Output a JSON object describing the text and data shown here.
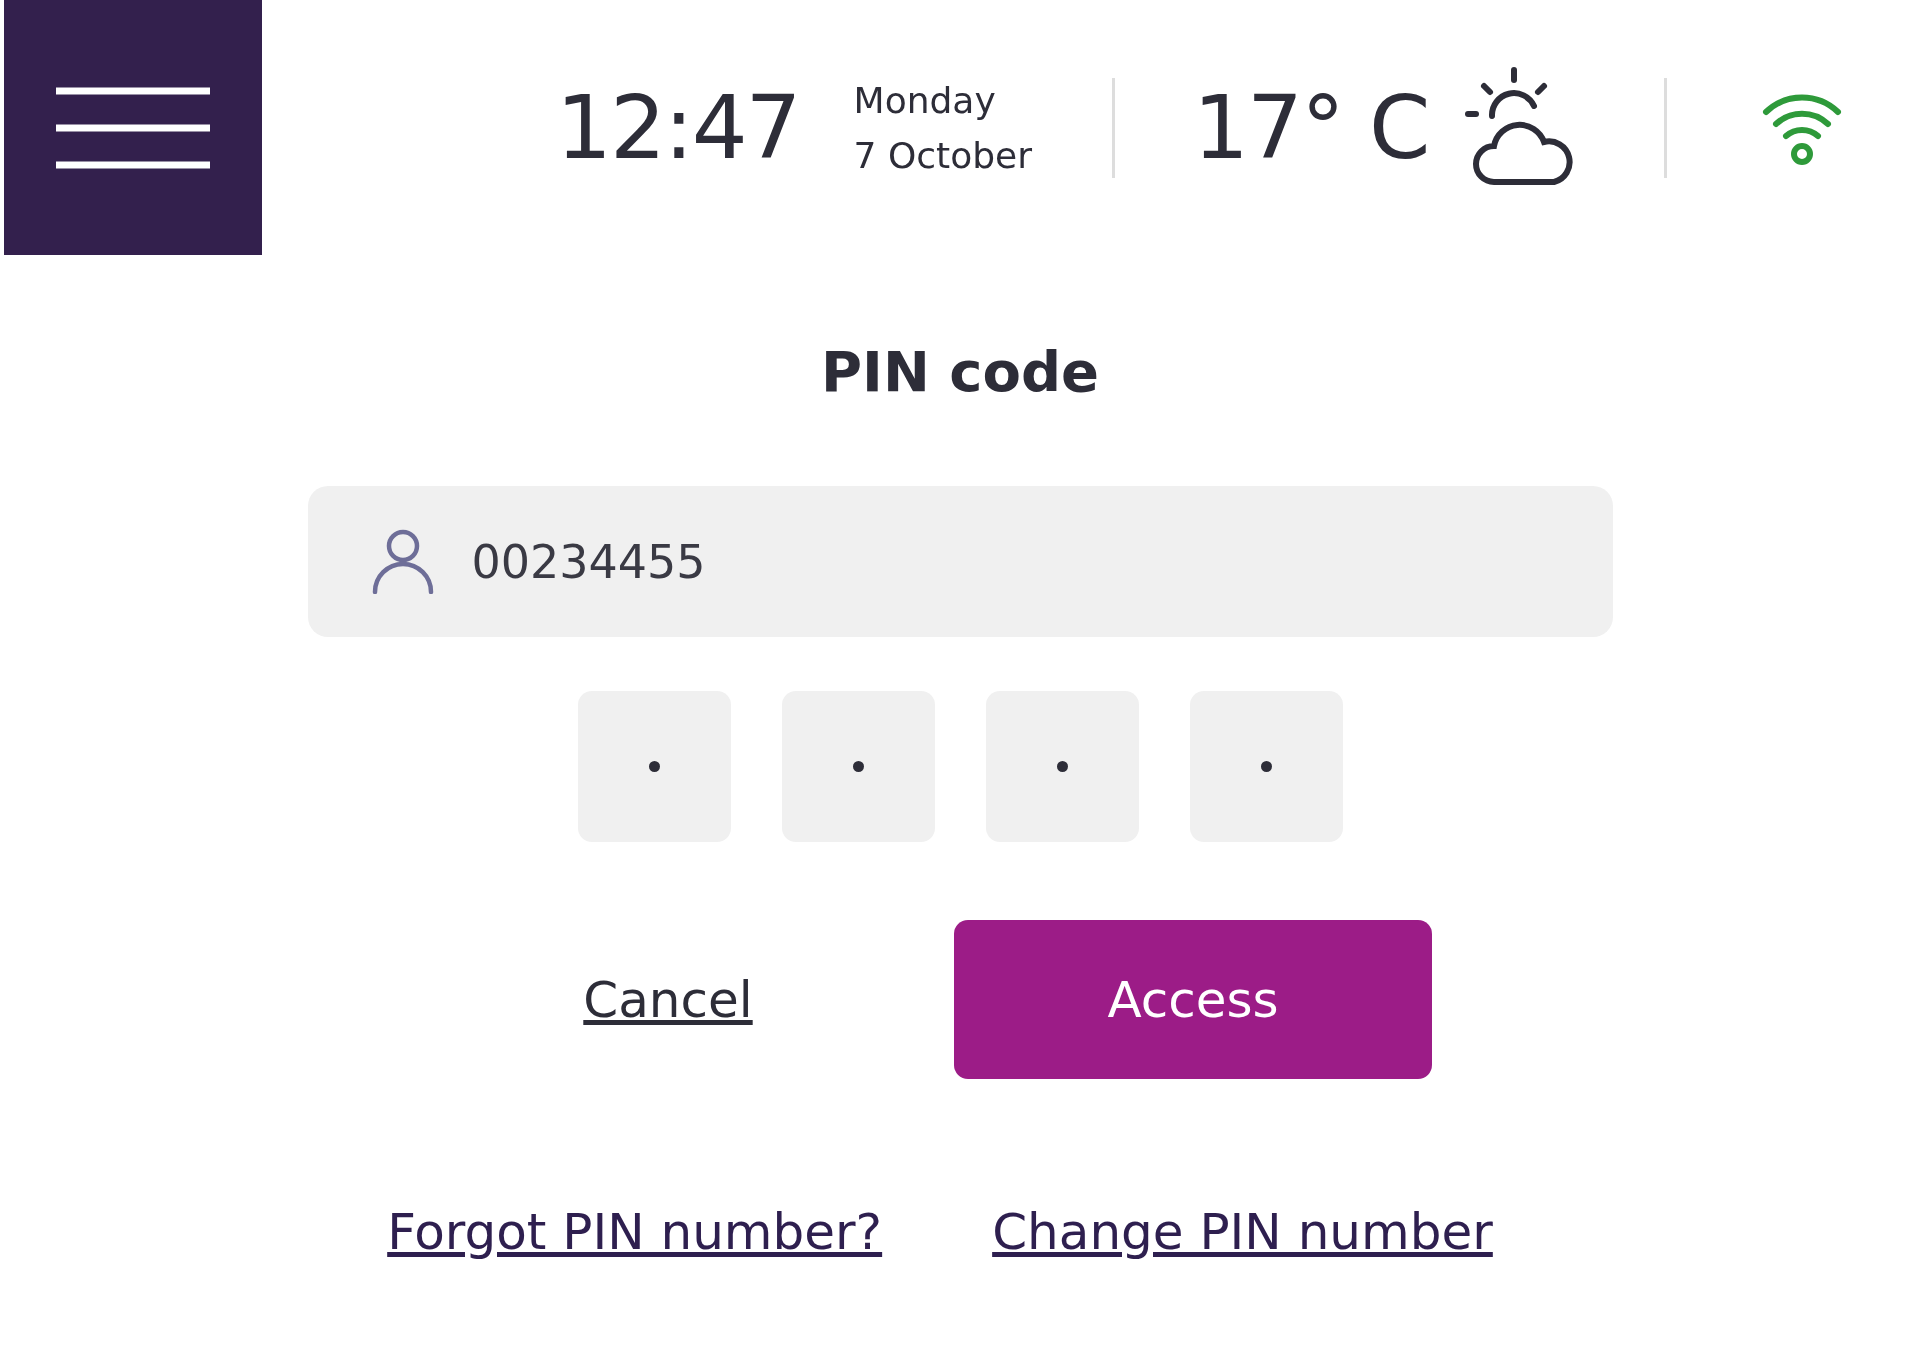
{
  "header": {
    "time": "12:47",
    "day": "Monday",
    "date": "7 October",
    "temperature": "17° C"
  },
  "title": "PIN code",
  "user_field": {
    "value": "00234455"
  },
  "pin_digits": [
    {
      "filled": true
    },
    {
      "filled": true
    },
    {
      "filled": true
    },
    {
      "filled": true
    }
  ],
  "buttons": [
    {
      "label": "Cancel",
      "kind": "link"
    },
    {
      "label": "Access",
      "kind": "primary"
    }
  ],
  "links": [
    "Forgot PIN number?",
    "Change PIN number"
  ]
}
